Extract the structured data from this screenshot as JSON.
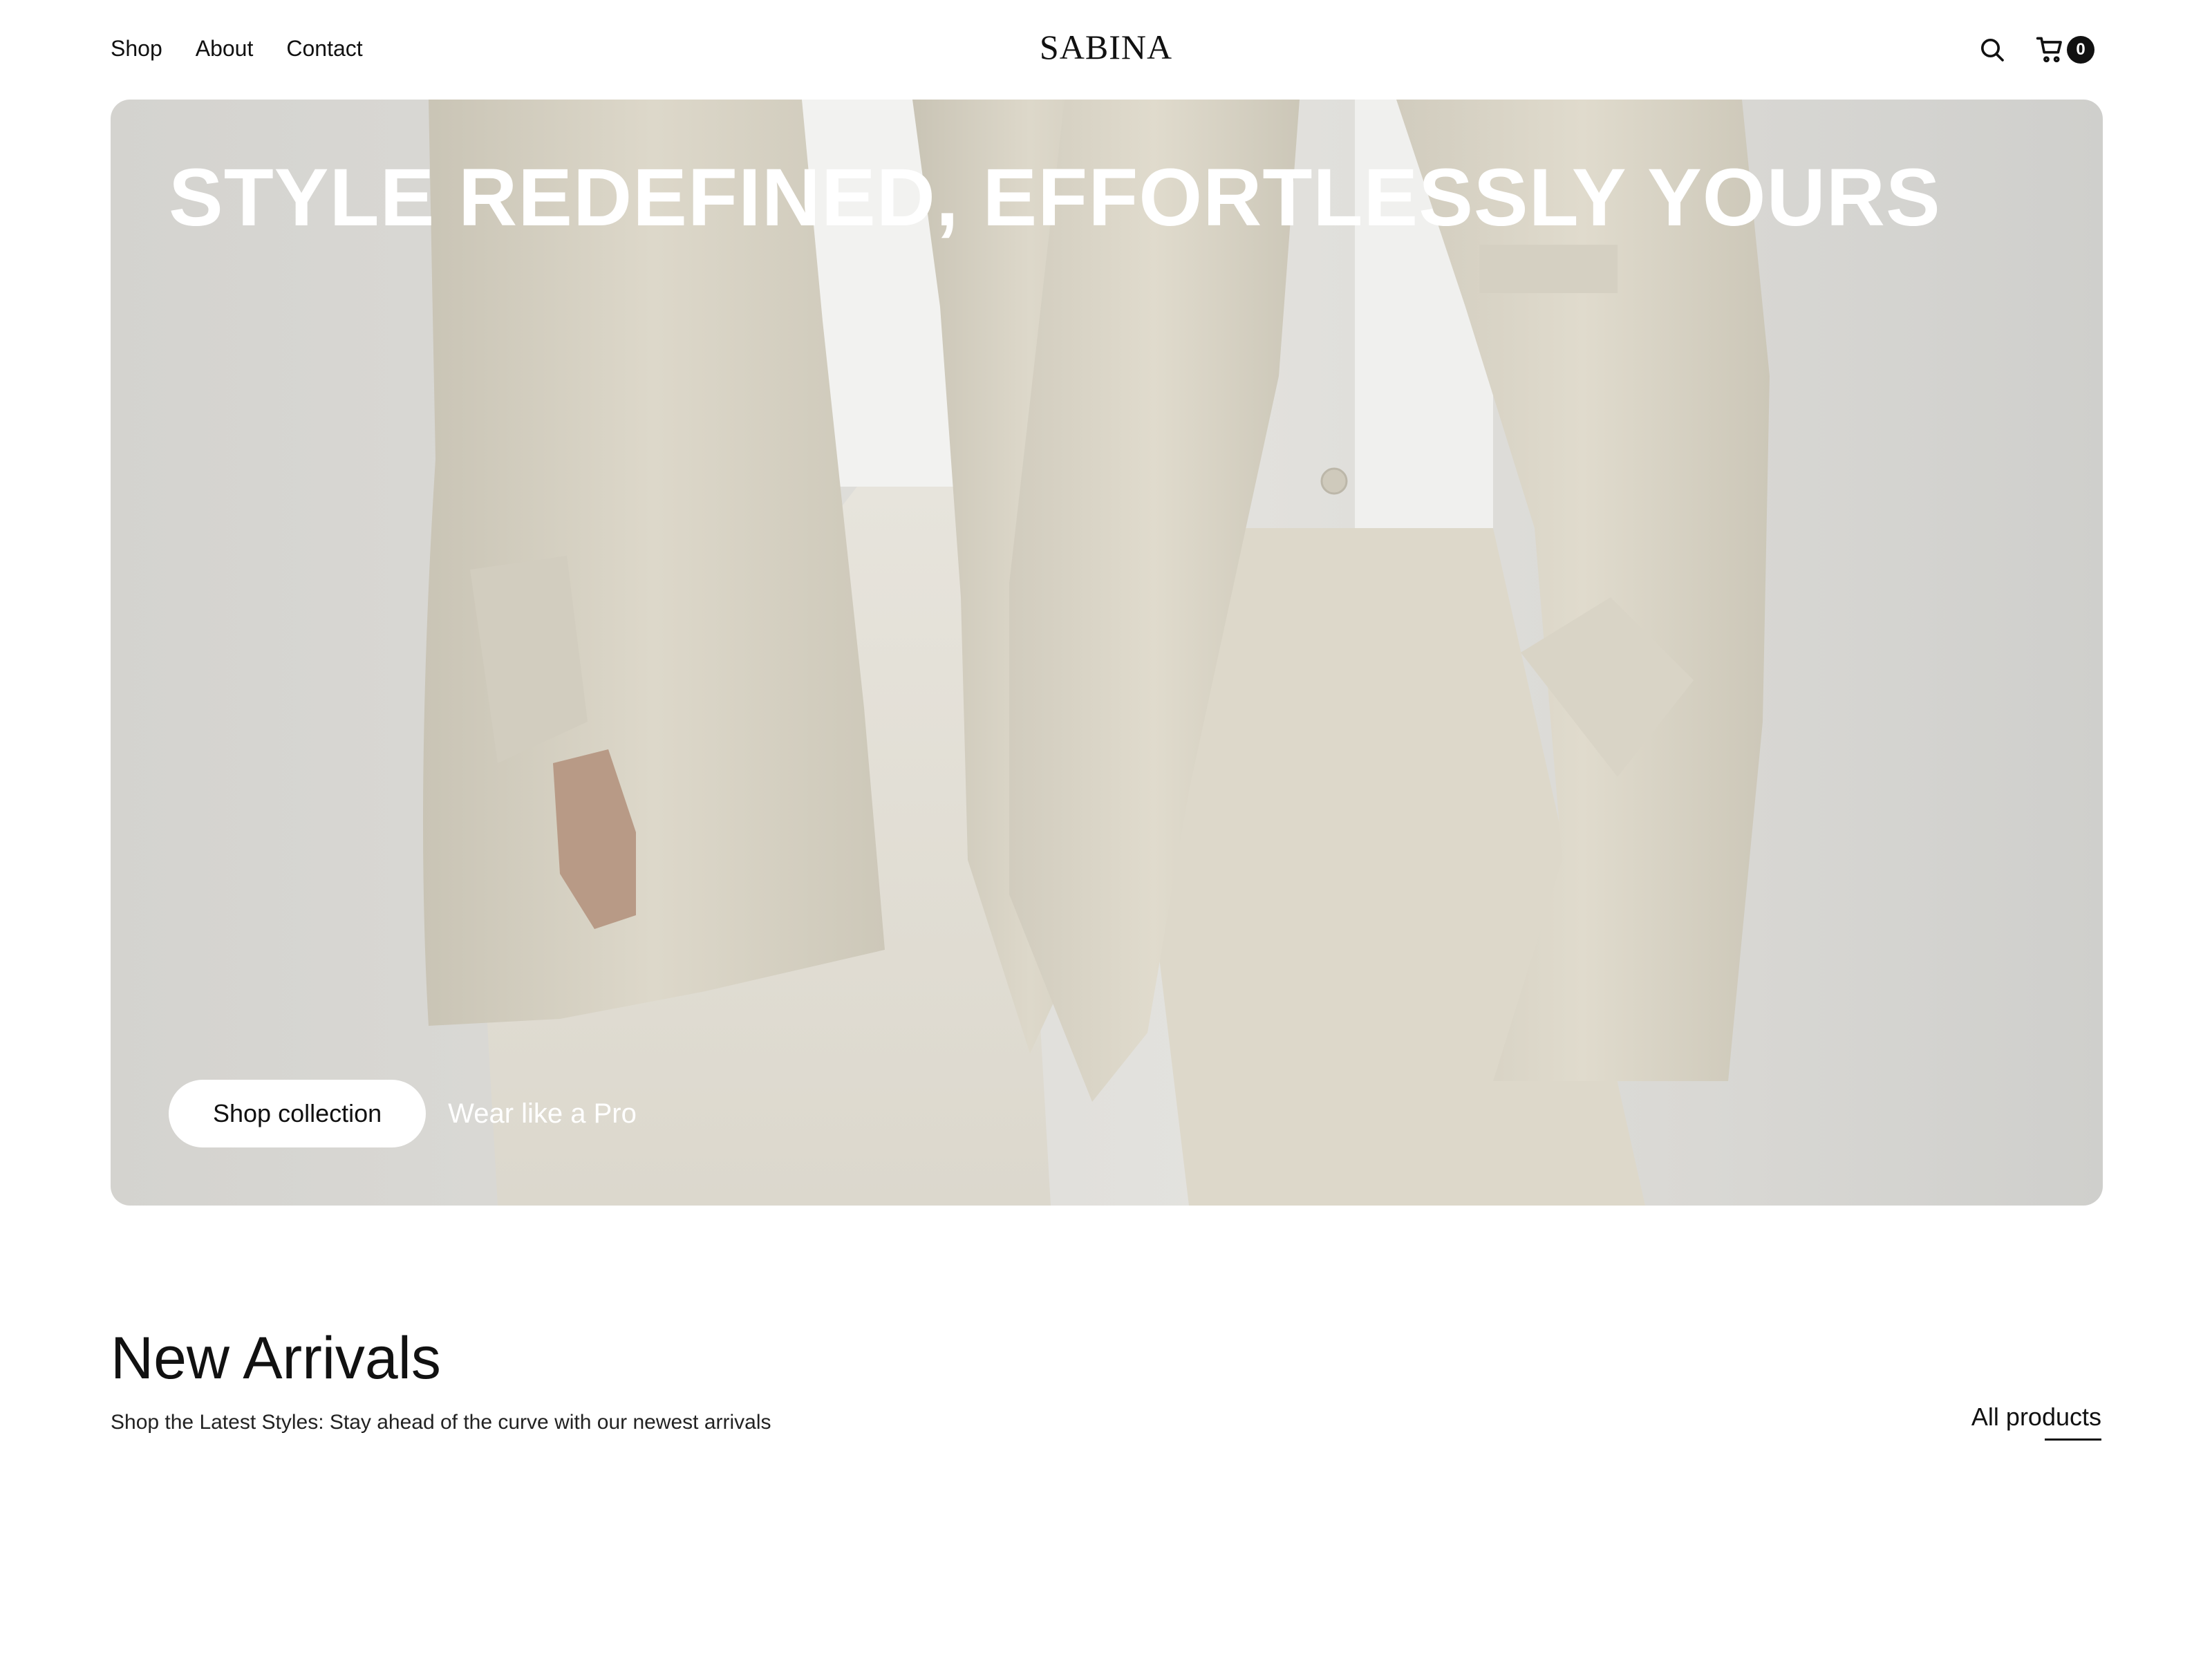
{
  "header": {
    "nav": [
      {
        "label": "Shop"
      },
      {
        "label": "About"
      },
      {
        "label": "Contact"
      }
    ],
    "logo": "SABINA",
    "cart_count": "0",
    "icons": [
      "search-icon",
      "cart-icon"
    ]
  },
  "hero": {
    "title": "STYLE REDEFINED, EFFORTLESSLY YOURS",
    "cta_label": "Shop collection",
    "tagline": "Wear like a Pro",
    "image": "two models in oversized beige blazers and white trousers"
  },
  "arrivals": {
    "title": "New Arrivals",
    "subtitle": "Shop the Latest Styles: Stay ahead of the curve with our newest arrivals",
    "link_label": "All products"
  },
  "colors": {
    "text": "#111111",
    "background": "#ffffff",
    "hero_bg": "#dcdbd7",
    "garment": "#d7d2c3",
    "button_bg": "#ffffff"
  }
}
